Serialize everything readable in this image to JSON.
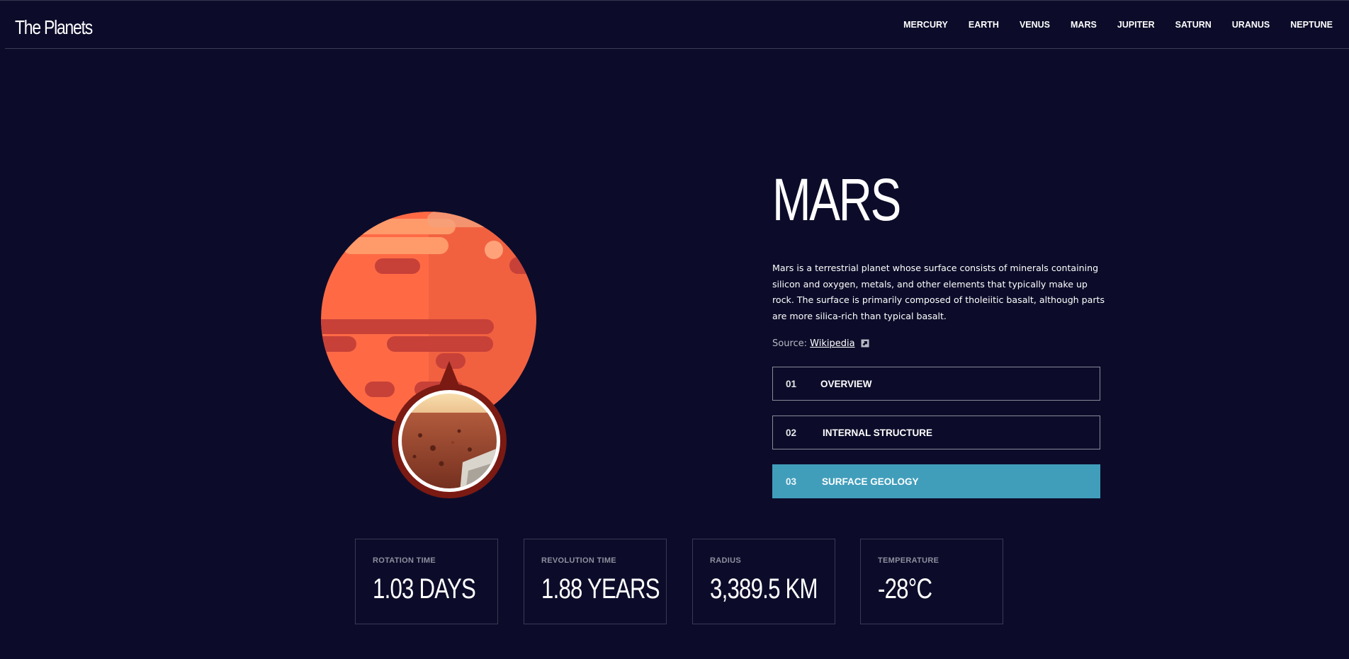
{
  "header": {
    "logo": "The Planets",
    "nav": [
      "MERCURY",
      "EARTH",
      "VENUS",
      "MARS",
      "JUPITER",
      "SATURN",
      "URANUS",
      "NEPTUNE"
    ]
  },
  "planet": {
    "name": "MARS",
    "description": "Mars is a terrestrial planet whose surface consists of minerals containing silicon and oxygen, metals, and other elements that typically make up rock. The surface is primarily composed of tholeiitic basalt, although parts are more silica-rich than typical basalt.",
    "source_prefix": "Source:",
    "source_link": "Wikipedia"
  },
  "tabs": [
    {
      "num": "01",
      "label": "OVERVIEW",
      "active": false
    },
    {
      "num": "02",
      "label": "INTERNAL STRUCTURE",
      "active": false
    },
    {
      "num": "03",
      "label": "SURFACE GEOLOGY",
      "active": true
    }
  ],
  "stats": [
    {
      "label": "ROTATION TIME",
      "value": "1.03 DAYS"
    },
    {
      "label": "REVOLUTION TIME",
      "value": "1.88 YEARS"
    },
    {
      "label": "RADIUS",
      "value": "3,389.5 KM"
    },
    {
      "label": "TEMPERATURE",
      "value": "-28°C"
    }
  ],
  "icons": {
    "external_link": "external-link-icon"
  },
  "colors": {
    "background": "#0c0c2a",
    "accent": "#419ebb",
    "planet_main": "#ff6a45",
    "planet_dark": "#c74139"
  }
}
